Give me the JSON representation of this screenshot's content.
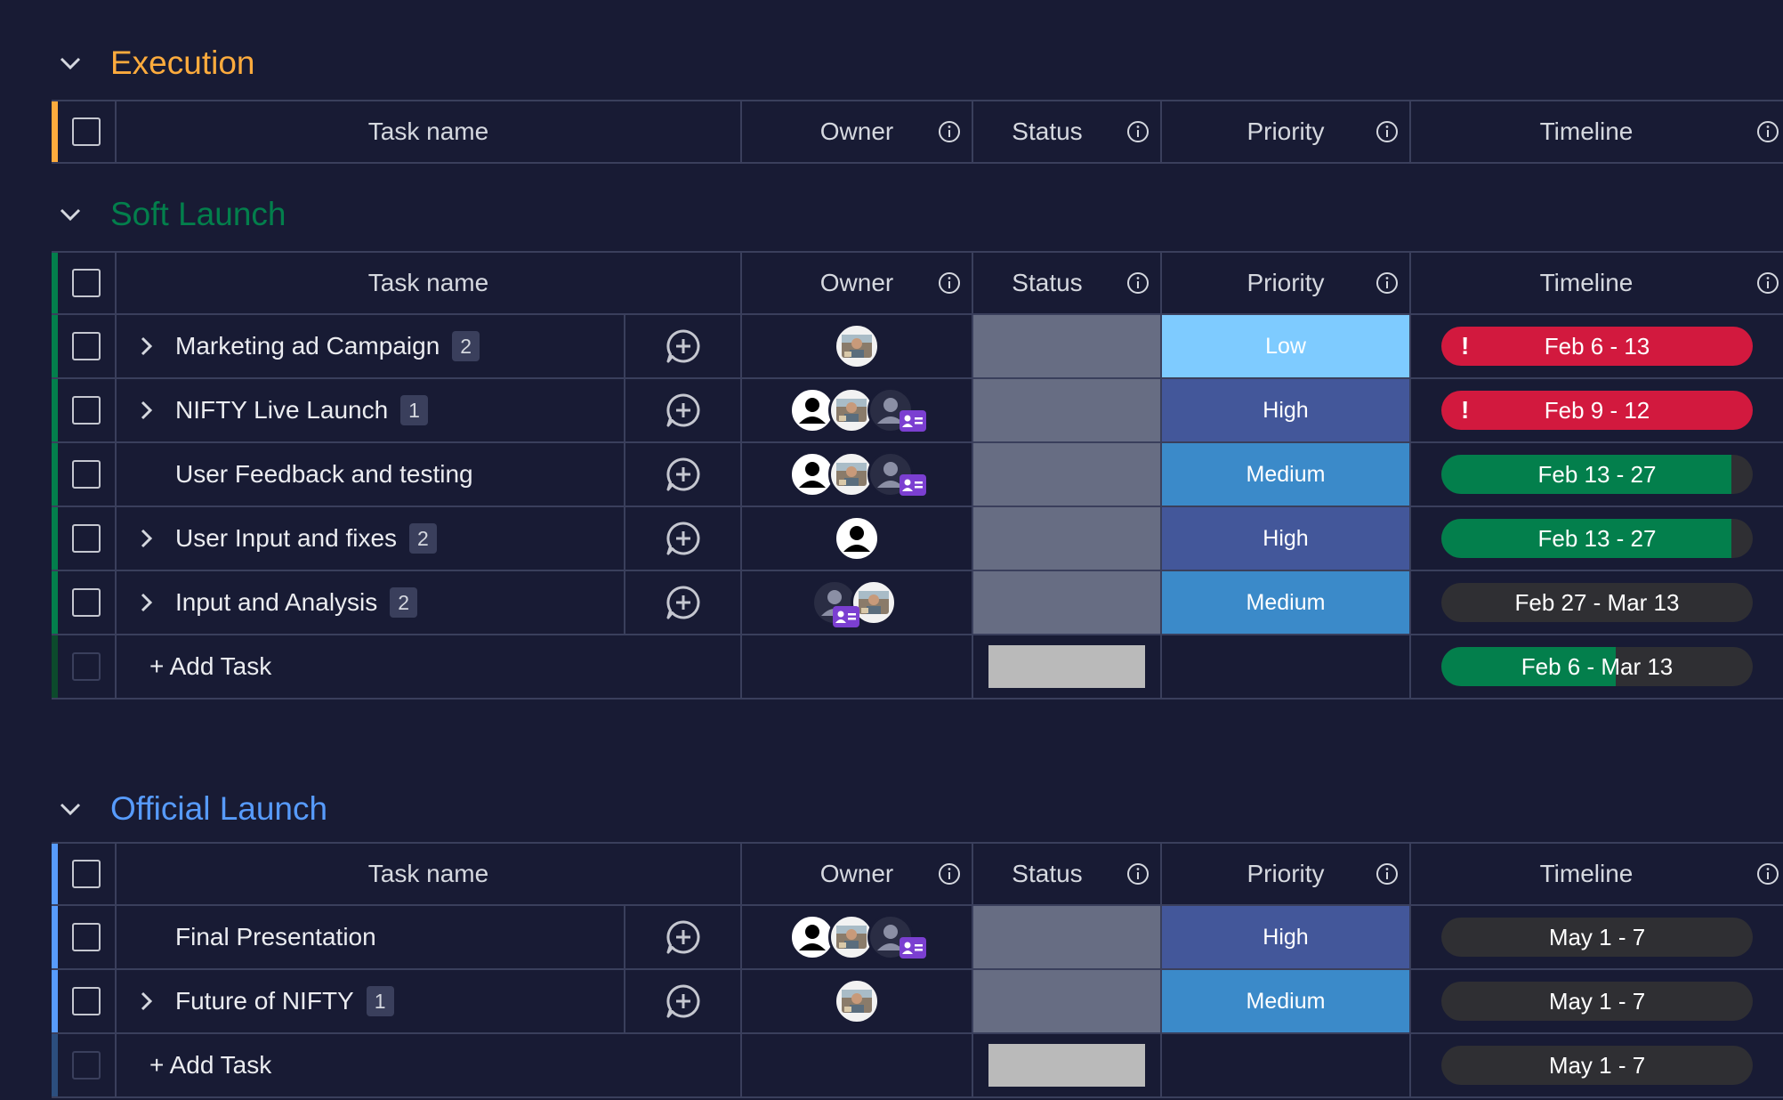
{
  "columns": {
    "task_name": "Task name",
    "owner": "Owner",
    "status": "Status",
    "priority": "Priority",
    "timeline": "Timeline"
  },
  "colors": {
    "background": "#181b34",
    "execution": "#fdab3d",
    "soft_launch": "#037f4c",
    "official_launch": "#579bfc",
    "priority_low": "#7ecbff",
    "priority_medium": "#3b8ac9",
    "priority_high": "#43579a",
    "timeline_overdue": "#d2193e",
    "timeline_progress": "#037f4c",
    "timeline_track": "#2f2f33",
    "status_empty": "#676d83"
  },
  "groups": [
    {
      "title": "Execution",
      "color": "#fdab3d"
    },
    {
      "title": "Soft Launch",
      "color": "#037f4c",
      "add_task": "+ Add Task",
      "summary_timeline": "Feb 6 - Mar 13",
      "summary_progress": 0.56,
      "tasks": [
        {
          "name": "Marketing ad Campaign",
          "subitems": "2",
          "owner": "photo",
          "priority": "Low",
          "timeline": "Feb 6 - 13",
          "overdue": true,
          "progress": 1
        },
        {
          "name": "NIFTY Live Launch",
          "subitems": "1",
          "owner": "group",
          "priority": "High",
          "timeline": "Feb 9 - 12",
          "overdue": true,
          "progress": 1
        },
        {
          "name": "User Feedback and testing",
          "subitems": "",
          "owner": "group",
          "priority": "Medium",
          "timeline": "Feb 13 - 27",
          "overdue": false,
          "progress": 0.93
        },
        {
          "name": "User Input and fixes",
          "subitems": "2",
          "owner": "person",
          "priority": "High",
          "timeline": "Feb 13 - 27",
          "overdue": false,
          "progress": 0.93
        },
        {
          "name": "Input and Analysis",
          "subitems": "2",
          "owner": "team",
          "priority": "Medium",
          "timeline": "Feb 27 - Mar 13",
          "overdue": false,
          "progress": 0
        }
      ]
    },
    {
      "title": "Official Launch",
      "color": "#579bfc",
      "add_task": "+ Add Task",
      "summary_timeline": "May 1 - 7",
      "summary_progress": 0,
      "tasks": [
        {
          "name": "Final Presentation",
          "subitems": "",
          "owner": "group",
          "priority": "High",
          "timeline": "May 1 - 7",
          "overdue": false,
          "progress": 0
        },
        {
          "name": "Future of NIFTY",
          "subitems": "1",
          "owner": "photo",
          "priority": "Medium",
          "timeline": "May 1 - 7",
          "overdue": false,
          "progress": 0
        }
      ]
    }
  ]
}
